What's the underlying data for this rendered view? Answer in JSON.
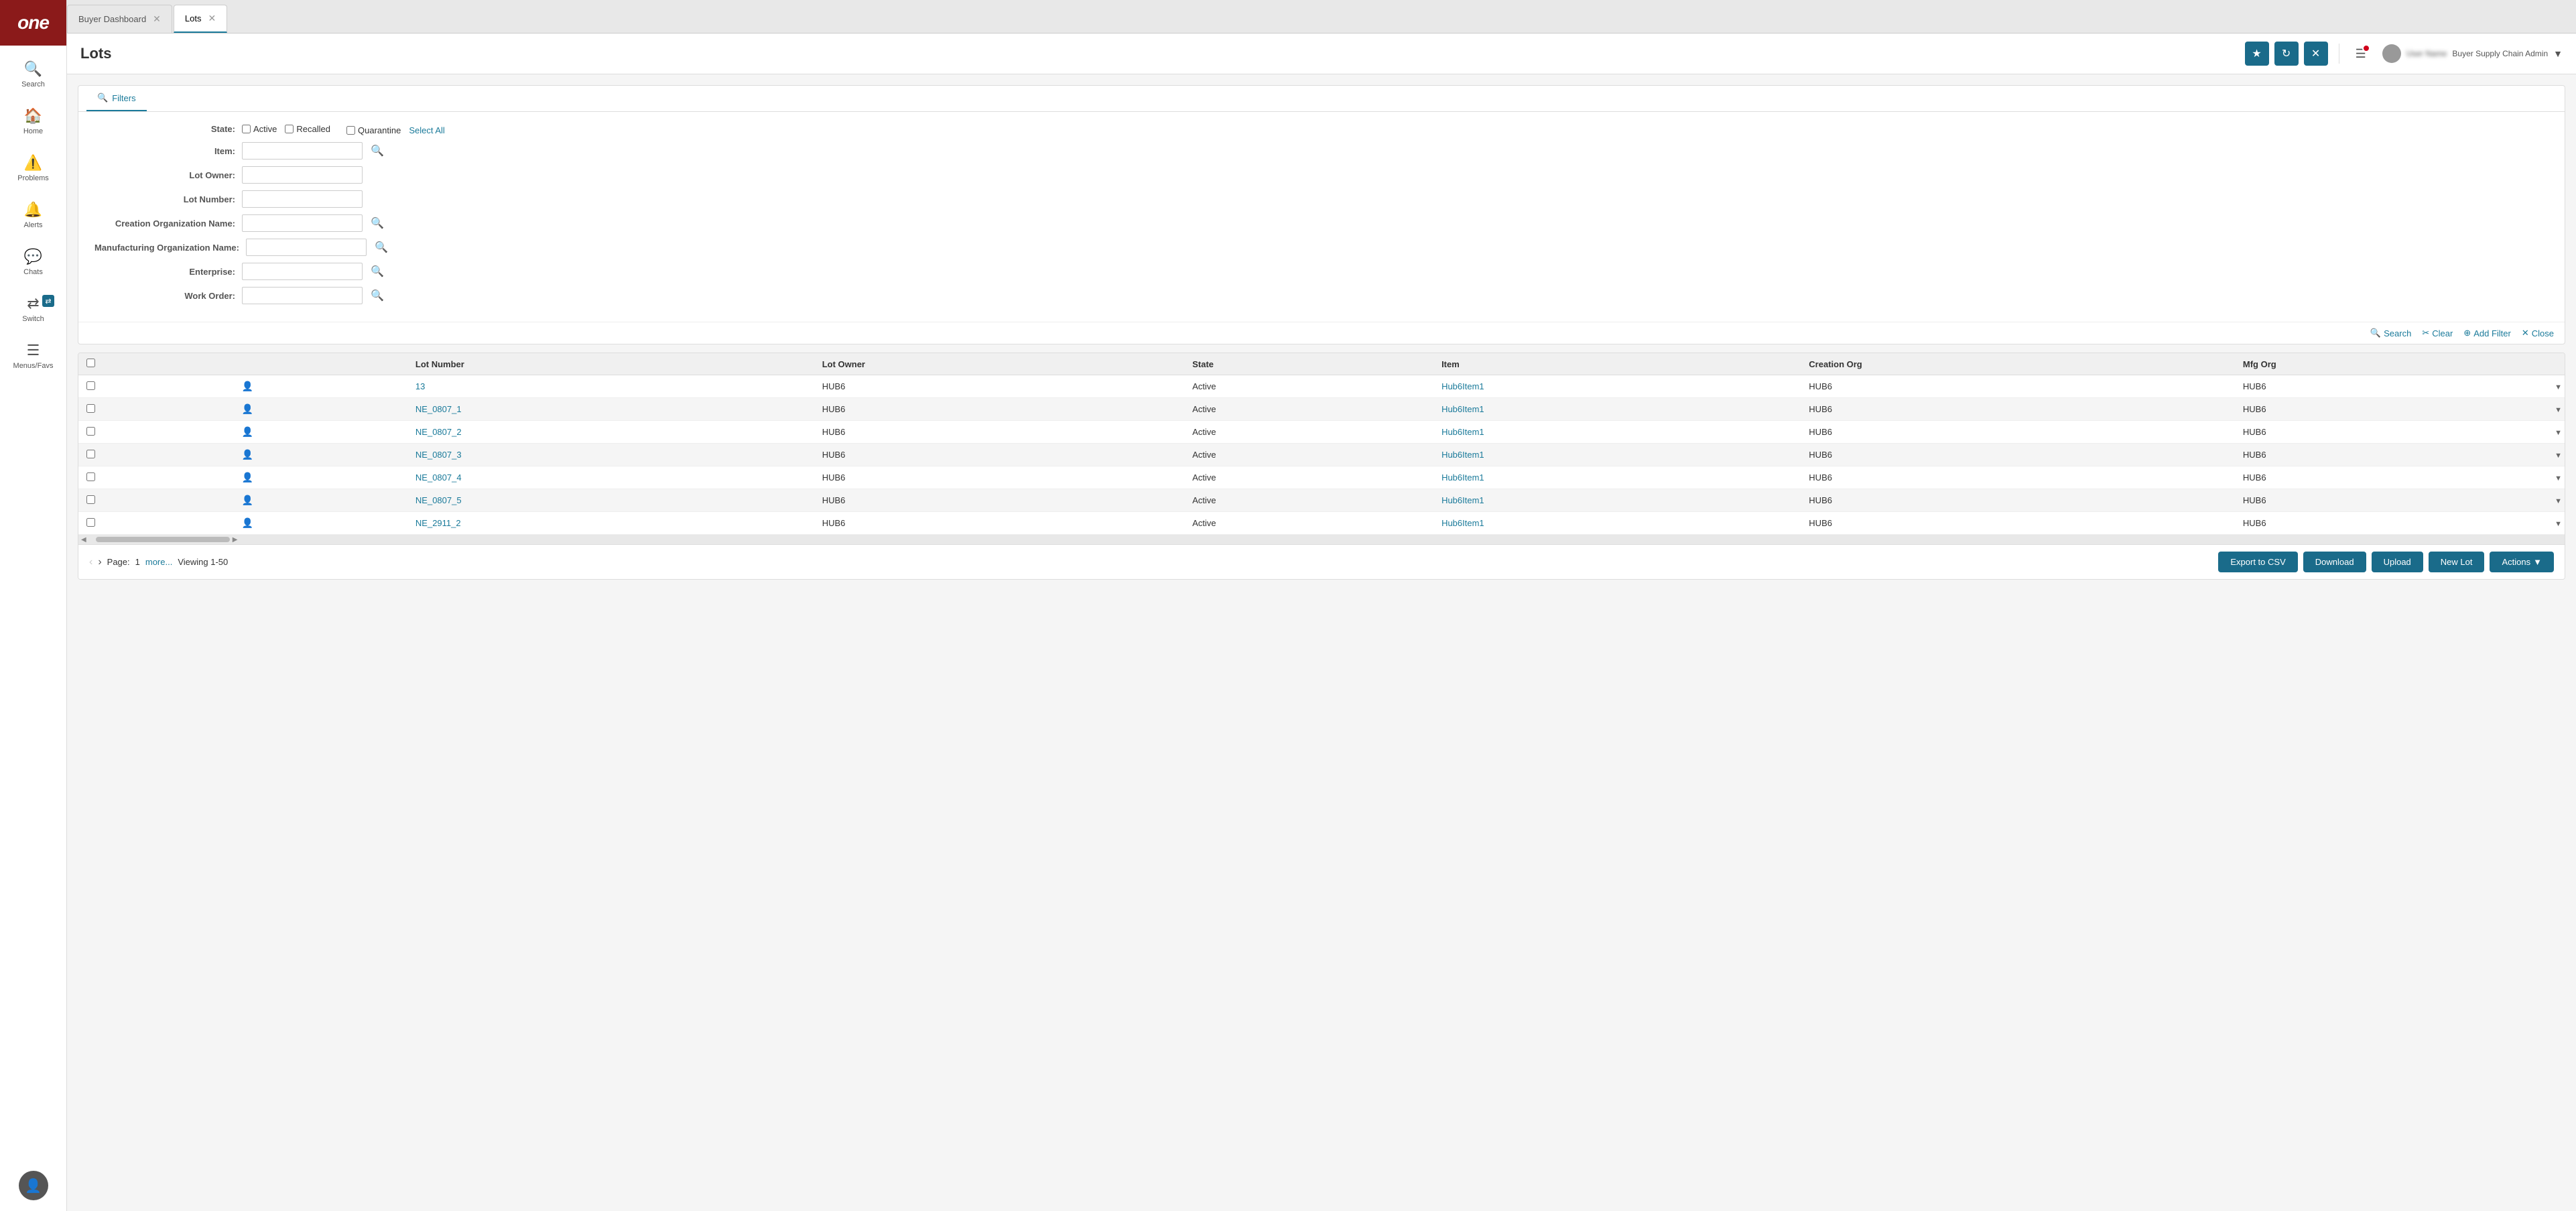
{
  "app": {
    "logo": "one",
    "sidebar": {
      "items": [
        {
          "id": "search",
          "label": "Search",
          "icon": "🔍"
        },
        {
          "id": "home",
          "label": "Home",
          "icon": "🏠"
        },
        {
          "id": "problems",
          "label": "Problems",
          "icon": "⚠️"
        },
        {
          "id": "alerts",
          "label": "Alerts",
          "icon": "🔔"
        },
        {
          "id": "chats",
          "label": "Chats",
          "icon": "💬"
        },
        {
          "id": "switch",
          "label": "Switch",
          "icon": "🔀"
        },
        {
          "id": "menus",
          "label": "Menus/Favs",
          "icon": "☰"
        }
      ]
    }
  },
  "tabs": [
    {
      "id": "buyer-dashboard",
      "label": "Buyer Dashboard",
      "active": false
    },
    {
      "id": "lots",
      "label": "Lots",
      "active": true
    }
  ],
  "header": {
    "title": "Lots",
    "star_btn": "★",
    "refresh_btn": "↻",
    "close_btn": "✕",
    "user_name": "User Name",
    "user_role": "Buyer Supply Chain Admin"
  },
  "filters": {
    "tab_label": "Filters",
    "state": {
      "label": "State:",
      "options": [
        {
          "id": "active",
          "label": "Active",
          "checked": false
        },
        {
          "id": "recalled",
          "label": "Recalled",
          "checked": false
        },
        {
          "id": "quarantine",
          "label": "Quarantine",
          "checked": false
        }
      ],
      "select_all": "Select All"
    },
    "item": {
      "label": "Item:",
      "value": ""
    },
    "lot_owner": {
      "label": "Lot Owner:",
      "value": ""
    },
    "lot_number": {
      "label": "Lot Number:",
      "value": ""
    },
    "creation_org": {
      "label": "Creation Organization Name:",
      "value": ""
    },
    "mfg_org": {
      "label": "Manufacturing Organization Name:",
      "value": ""
    },
    "enterprise": {
      "label": "Enterprise:",
      "value": ""
    },
    "work_order": {
      "label": "Work Order:",
      "value": ""
    },
    "actions": {
      "search": "Search",
      "clear": "Clear",
      "add_filter": "Add Filter",
      "close": "Close"
    }
  },
  "table": {
    "columns": [
      "",
      "",
      "Lot Number",
      "Lot Owner",
      "State",
      "Item",
      "Creation Org",
      "Mfg Org"
    ],
    "rows": [
      {
        "id": "13",
        "lot_number": "13",
        "lot_owner": "HUB6",
        "state": "Active",
        "item": "Hub6Item1",
        "creation_org": "HUB6",
        "mfg_org": "HUB6"
      },
      {
        "id": "NE_0807_1",
        "lot_number": "NE_0807_1",
        "lot_owner": "HUB6",
        "state": "Active",
        "item": "Hub6Item1",
        "creation_org": "HUB6",
        "mfg_org": "HUB6"
      },
      {
        "id": "NE_0807_2",
        "lot_number": "NE_0807_2",
        "lot_owner": "HUB6",
        "state": "Active",
        "item": "Hub6Item1",
        "creation_org": "HUB6",
        "mfg_org": "HUB6"
      },
      {
        "id": "NE_0807_3",
        "lot_number": "NE_0807_3",
        "lot_owner": "HUB6",
        "state": "Active",
        "item": "Hub6Item1",
        "creation_org": "HUB6",
        "mfg_org": "HUB6"
      },
      {
        "id": "NE_0807_4",
        "lot_number": "NE_0807_4",
        "lot_owner": "HUB6",
        "state": "Active",
        "item": "Hub6Item1",
        "creation_org": "HUB6",
        "mfg_org": "HUB6"
      },
      {
        "id": "NE_0807_5",
        "lot_number": "NE_0807_5",
        "lot_owner": "HUB6",
        "state": "Active",
        "item": "Hub6Item1",
        "creation_org": "HUB6",
        "mfg_org": "HUB6"
      },
      {
        "id": "NE_2911_2",
        "lot_number": "NE_2911_2",
        "lot_owner": "HUB6",
        "state": "Active",
        "item": "Hub6Item1",
        "creation_org": "HUB6",
        "mfg_org": "HUB6"
      }
    ]
  },
  "footer": {
    "page_label": "Page:",
    "page_num": "1",
    "more_label": "more...",
    "viewing_label": "Viewing 1-50",
    "buttons": [
      {
        "id": "export-csv",
        "label": "Export to CSV"
      },
      {
        "id": "download",
        "label": "Download"
      },
      {
        "id": "upload",
        "label": "Upload"
      },
      {
        "id": "new-lot",
        "label": "New Lot"
      },
      {
        "id": "actions",
        "label": "Actions"
      }
    ]
  }
}
